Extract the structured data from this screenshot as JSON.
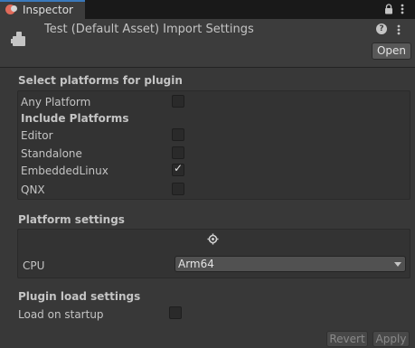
{
  "tab": {
    "label": "Inspector",
    "icon": "inspector-icon"
  },
  "header": {
    "title": "Test (Default Asset) Import Settings",
    "open_label": "Open",
    "help_glyph": "?"
  },
  "platforms": {
    "title": "Select platforms for plugin",
    "any_platform": {
      "label": "Any Platform",
      "checked": false
    },
    "include_title": "Include Platforms",
    "items": [
      {
        "label": "Editor",
        "checked": false
      },
      {
        "label": "Standalone",
        "checked": false
      },
      {
        "label": "EmbeddedLinux",
        "checked": true
      },
      {
        "label": "QNX",
        "checked": false
      }
    ]
  },
  "platform_settings": {
    "title": "Platform settings",
    "cpu_label": "CPU",
    "cpu_value": "Arm64"
  },
  "load_settings": {
    "title": "Plugin load settings",
    "load_on_startup": {
      "label": "Load on startup",
      "checked": false
    }
  },
  "footer": {
    "revert_label": "Revert",
    "apply_label": "Apply"
  },
  "colors": {
    "accent": "#3a79bb",
    "background": "#383838",
    "panel": "#333333"
  }
}
